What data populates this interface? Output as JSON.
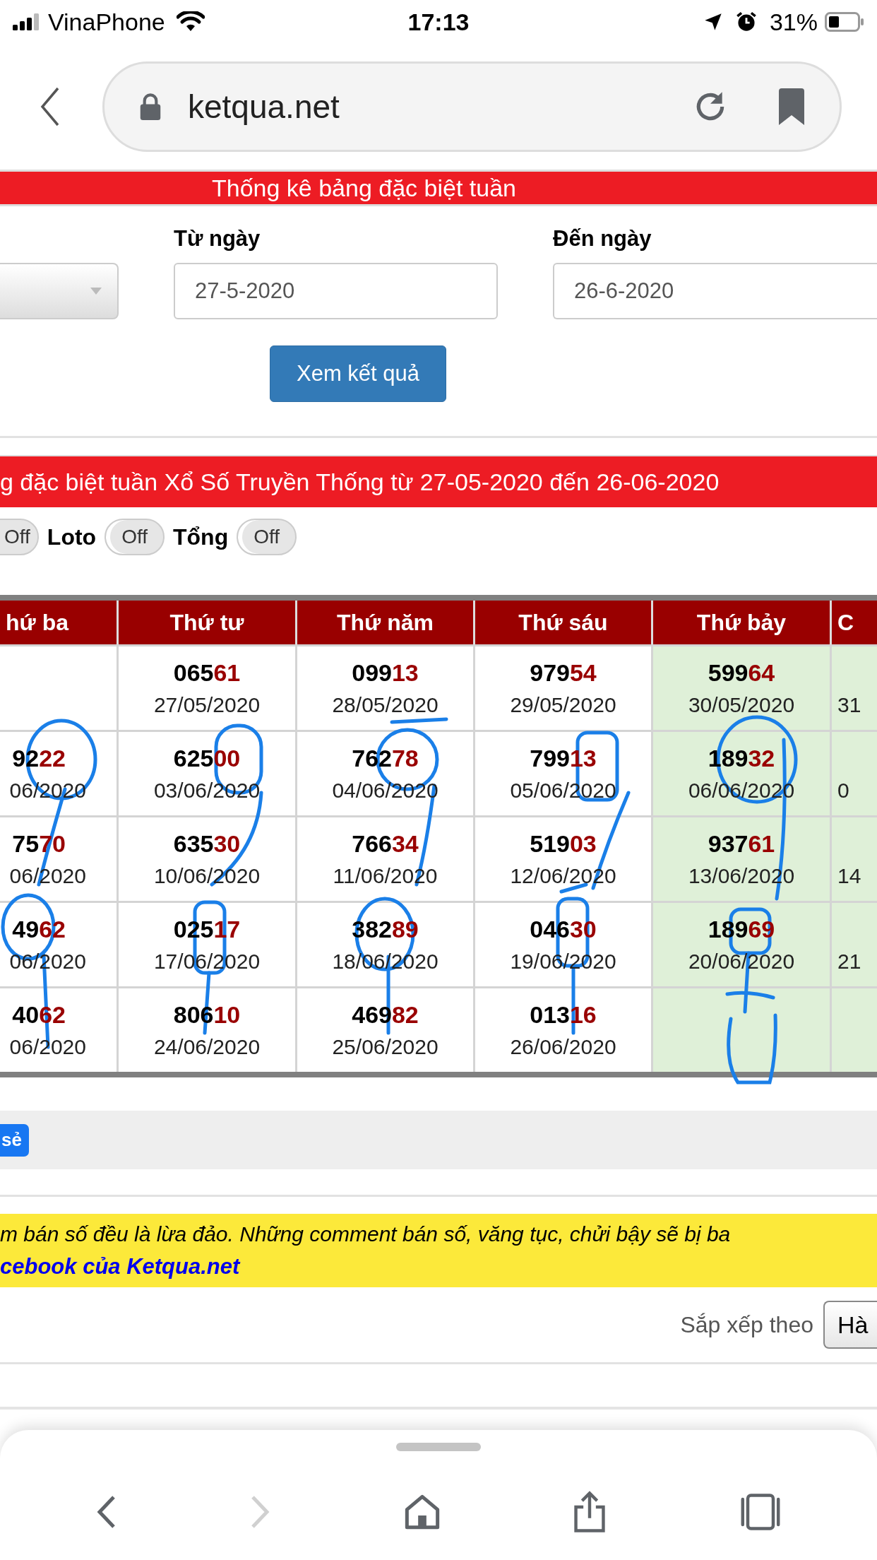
{
  "status_bar": {
    "carrier": "VinaPhone",
    "time": "17:13",
    "battery": "31%"
  },
  "browser": {
    "url": "ketqua.net"
  },
  "page_title": "Thống kê bảng đặc biệt tuần",
  "form": {
    "from_label": "Từ ngày",
    "from_value": "27-5-2020",
    "to_label": "Đến ngày",
    "to_value": "26-6-2020",
    "submit": "Xem kết quả"
  },
  "banner": "g đặc biệt tuần Xổ Số Truyền Thống từ 27-05-2020 đến 26-06-2020",
  "toggles": [
    {
      "text": "Off",
      "on": false
    },
    {
      "label": "Loto",
      "text": "Off",
      "on": false
    },
    {
      "label": "Tổng",
      "text": "Off",
      "on": false
    }
  ],
  "table": {
    "columns": [
      {
        "label": "hứ ba",
        "highlighted": false
      },
      {
        "label": "Thứ tư",
        "highlighted": false
      },
      {
        "label": "Thứ năm",
        "highlighted": false
      },
      {
        "label": "Thứ sáu",
        "highlighted": false
      },
      {
        "label": "Thứ bảy",
        "highlighted": true
      },
      {
        "label": "C",
        "highlighted": true
      }
    ],
    "rows": [
      [
        null,
        {
          "number_head": "065",
          "number_tail": "61",
          "date": "27/05/2020"
        },
        {
          "number_head": "099",
          "number_tail": "13",
          "date": "28/05/2020"
        },
        {
          "number_head": "979",
          "number_tail": "54",
          "date": "29/05/2020"
        },
        {
          "number_head": "599",
          "number_tail": "64",
          "date": "30/05/2020"
        },
        {
          "date": "31"
        }
      ],
      [
        {
          "number_head": "92",
          "number_tail": "22",
          "date": "06/2020"
        },
        {
          "number_head": "625",
          "number_tail": "00",
          "date": "03/06/2020"
        },
        {
          "number_head": "762",
          "number_tail": "78",
          "date": "04/06/2020"
        },
        {
          "number_head": "799",
          "number_tail": "13",
          "date": "05/06/2020"
        },
        {
          "number_head": "189",
          "number_tail": "32",
          "date": "06/06/2020"
        },
        {
          "date": "0"
        }
      ],
      [
        {
          "number_head": "75",
          "number_tail": "70",
          "date": "06/2020"
        },
        {
          "number_head": "635",
          "number_tail": "30",
          "date": "10/06/2020"
        },
        {
          "number_head": "766",
          "number_tail": "34",
          "date": "11/06/2020"
        },
        {
          "number_head": "519",
          "number_tail": "03",
          "date": "12/06/2020"
        },
        {
          "number_head": "937",
          "number_tail": "61",
          "date": "13/06/2020"
        },
        {
          "date": "14"
        }
      ],
      [
        {
          "number_head": "49",
          "number_tail": "62",
          "date": "06/2020"
        },
        {
          "number_head": "025",
          "number_tail": "17",
          "date": "17/06/2020"
        },
        {
          "number_head": "382",
          "number_tail": "89",
          "date": "18/06/2020"
        },
        {
          "number_head": "046",
          "number_tail": "30",
          "date": "19/06/2020"
        },
        {
          "number_head": "189",
          "number_tail": "69",
          "date": "20/06/2020"
        },
        {
          "date": "21"
        }
      ],
      [
        {
          "number_head": "40",
          "number_tail": "62",
          "date": "06/2020"
        },
        {
          "number_head": "806",
          "number_tail": "10",
          "date": "24/06/2020"
        },
        {
          "number_head": "469",
          "number_tail": "82",
          "date": "25/06/2020"
        },
        {
          "number_head": "013",
          "number_tail": "16",
          "date": "26/06/2020"
        },
        null,
        null
      ]
    ]
  },
  "share_button": "sẻ",
  "notice": {
    "text": "m bán số đều là lừa đảo. Những comment bán số, văng tục, chửi bậy sẽ bị ba",
    "link": "cebook của Ketqua.net"
  },
  "sort": {
    "label": "Sắp xếp theo",
    "value": "Hà"
  },
  "toolbar": [
    {
      "kind": "back",
      "disabled": false
    },
    {
      "kind": "forward",
      "disabled": true
    },
    {
      "kind": "home",
      "disabled": false
    },
    {
      "kind": "share",
      "disabled": false
    },
    {
      "kind": "tabs",
      "disabled": false
    }
  ]
}
